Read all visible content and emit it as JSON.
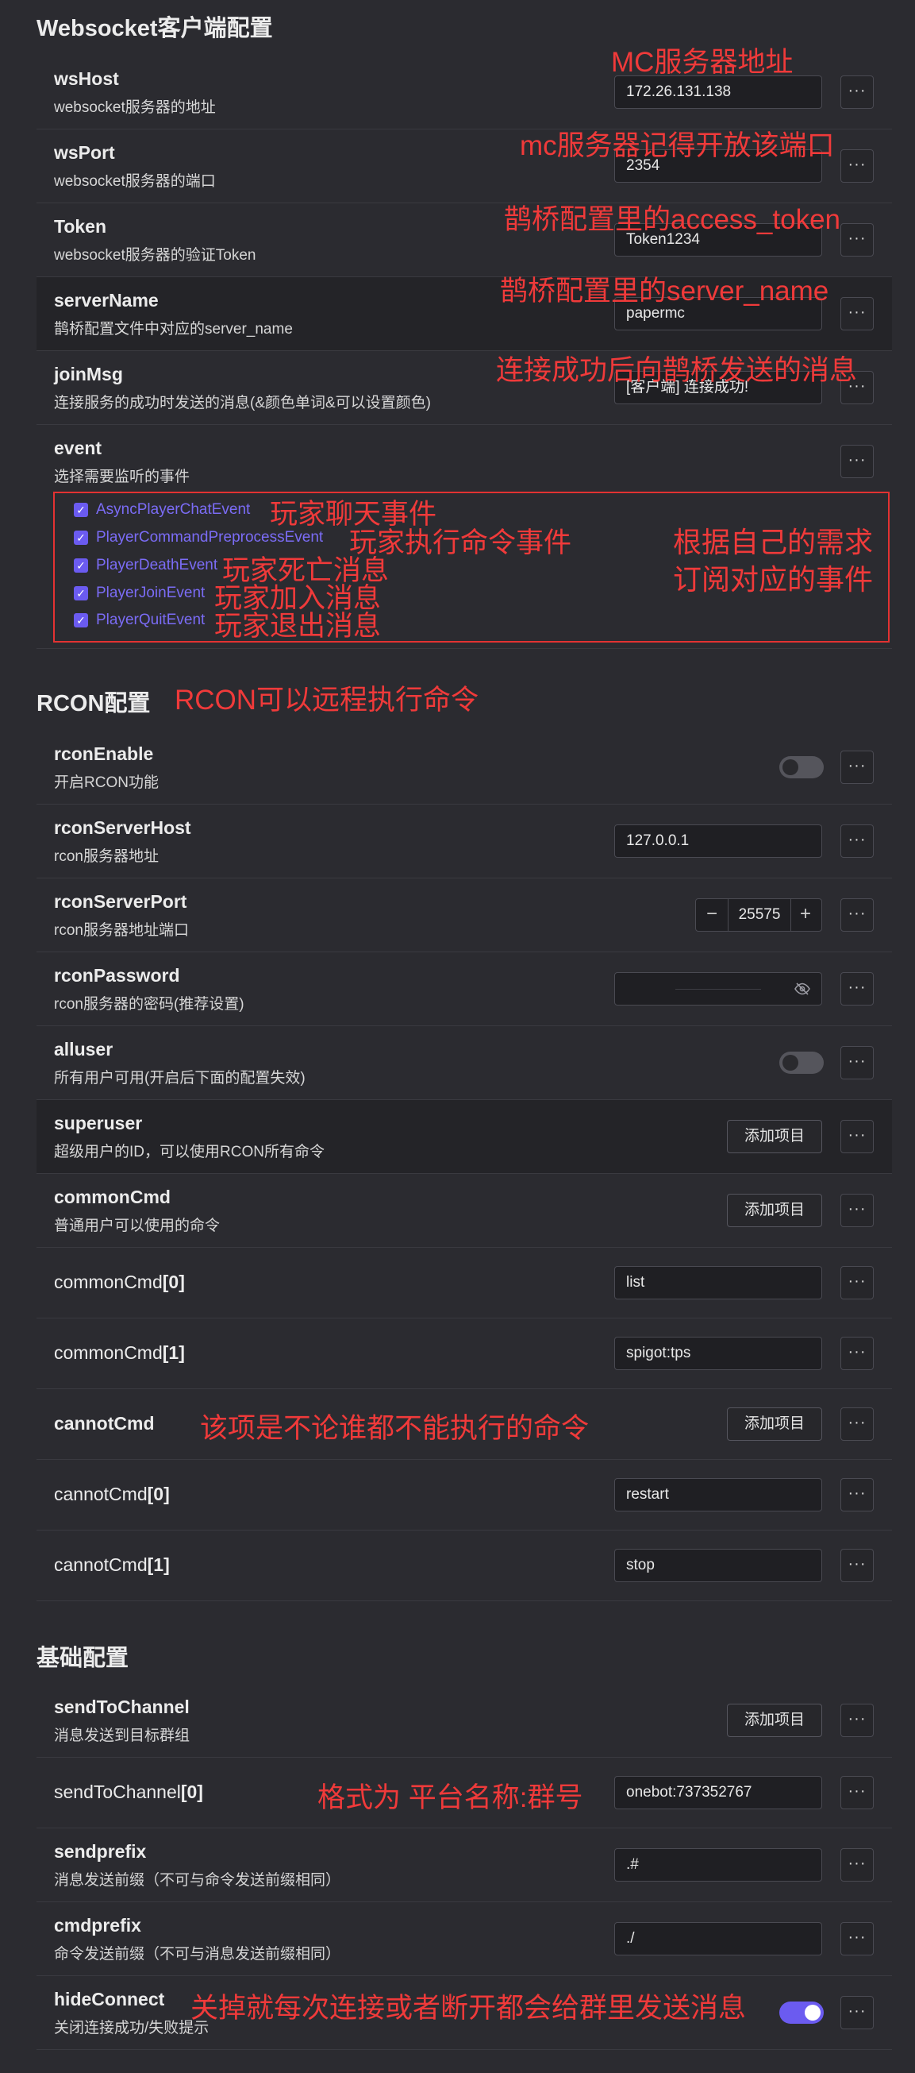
{
  "sections": {
    "websocket": "Websocket客户端配置",
    "rcon": "RCON配置",
    "basic": "基础配置"
  },
  "ws": {
    "wsHost": {
      "title": "wsHost",
      "desc": "websocket服务器的地址",
      "value": "172.26.131.138"
    },
    "wsPort": {
      "title": "wsPort",
      "desc": "websocket服务器的端口",
      "value": "2354"
    },
    "token": {
      "title": "Token",
      "desc": "websocket服务器的验证Token",
      "value": "Token1234"
    },
    "serverName": {
      "title": "serverName",
      "desc": "鹊桥配置文件中对应的server_name",
      "value": "papermc"
    },
    "joinMsg": {
      "title": "joinMsg",
      "desc": "连接服务的成功时发送的消息(&颜色单词&可以设置颜色)",
      "value": "[客户端] 连接成功!"
    },
    "event": {
      "title": "event",
      "desc": "选择需要监听的事件",
      "items": [
        "AsyncPlayerChatEvent",
        "PlayerCommandPreprocessEvent",
        "PlayerDeathEvent",
        "PlayerJoinEvent",
        "PlayerQuitEvent"
      ]
    }
  },
  "rcon": {
    "enable": {
      "title": "rconEnable",
      "desc": "开启RCON功能",
      "checked": false
    },
    "host": {
      "title": "rconServerHost",
      "desc": "rcon服务器地址",
      "value": "127.0.0.1"
    },
    "port": {
      "title": "rconServerPort",
      "desc": "rcon服务器地址端口",
      "value": "25575",
      "minus": "−",
      "plus": "+"
    },
    "password": {
      "title": "rconPassword",
      "desc": "rcon服务器的密码(推荐设置)",
      "icon": "eye-off-icon"
    },
    "alluser": {
      "title": "alluser",
      "desc": "所有用户可用(开启后下面的配置失效)",
      "checked": false
    },
    "superuser": {
      "title": "superuser",
      "desc": "超级用户的ID，可以使用RCON所有命令"
    },
    "commonCmd": {
      "title": "commonCmd",
      "desc": "普通用户可以使用的命令"
    },
    "commonCmd0": {
      "name": "commonCmd",
      "index": "[0]",
      "value": "list"
    },
    "commonCmd1": {
      "name": "commonCmd",
      "index": "[1]",
      "value": "spigot:tps"
    },
    "cannotCmd": {
      "title": "cannotCmd"
    },
    "cannotCmd0": {
      "name": "cannotCmd",
      "index": "[0]",
      "value": "restart"
    },
    "cannotCmd1": {
      "name": "cannotCmd",
      "index": "[1]",
      "value": "stop"
    }
  },
  "basic": {
    "sendToChannel": {
      "title": "sendToChannel",
      "desc": "消息发送到目标群组"
    },
    "sendToChannel0": {
      "name": "sendToChannel",
      "index": "[0]",
      "value": "onebot:737352767"
    },
    "sendprefix": {
      "title": "sendprefix",
      "desc": "消息发送前缀（不可与命令发送前缀相同）",
      "value": ".#"
    },
    "cmdprefix": {
      "title": "cmdprefix",
      "desc": "命令发送前缀（不可与消息发送前缀相同）",
      "value": "./"
    },
    "hideConnect": {
      "title": "hideConnect",
      "desc": "关闭连接成功/失败提示",
      "checked": true
    }
  },
  "common": {
    "add_label": "添加项目",
    "more_label": "···"
  },
  "annotations": {
    "mcAddr": "MC服务器地址",
    "port": "mc服务器记得开放该端口",
    "token": "鹊桥配置里的access_token",
    "serverName": "鹊桥配置里的server_name",
    "joinMsg": "连接成功后向鹊桥发送的消息",
    "ev1": "玩家聊天事件",
    "ev2": "玩家执行命令事件",
    "ev3": "玩家死亡消息",
    "ev4": "玩家加入消息",
    "ev5": "玩家退出消息",
    "subscribe1": "根据自己的需求",
    "subscribe2": "订阅对应的事件",
    "rcon": "RCON可以远程执行命令",
    "cannot": "该项是不论谁都不能执行的命令",
    "format": "格式为 平台名称:群号",
    "hide": "关掉就每次连接或者断开都会给群里发送消息"
  },
  "colors": {
    "accent": "#6b5bf0",
    "annotation": "#f03a3a",
    "background": "#2b2b30"
  }
}
